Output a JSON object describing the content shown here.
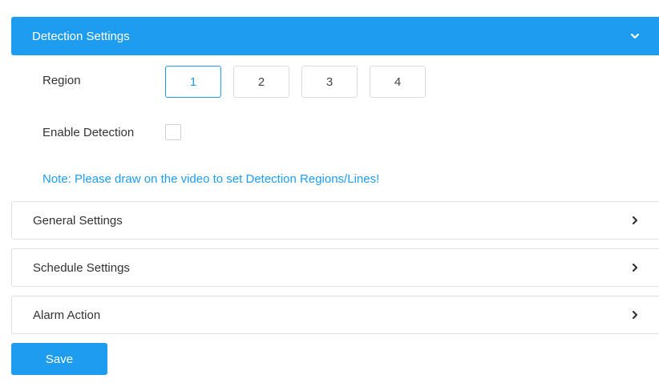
{
  "detection_panel": {
    "title": "Detection Settings",
    "region_label": "Region",
    "regions": [
      "1",
      "2",
      "3",
      "4"
    ],
    "selected_region": "1",
    "enable_label": "Enable Detection",
    "enable_checked": false,
    "note": "Note: Please draw on the video to set Detection Regions/Lines!"
  },
  "sections": [
    {
      "label": "General Settings"
    },
    {
      "label": "Schedule Settings"
    },
    {
      "label": "Alarm Action"
    }
  ],
  "save_label": "Save",
  "colors": {
    "accent": "#1e9cf0",
    "border": "#dcdfe4",
    "text": "#333333"
  },
  "icons": {
    "expanded": "chevron-down-icon",
    "collapsed": "chevron-right-icon"
  }
}
